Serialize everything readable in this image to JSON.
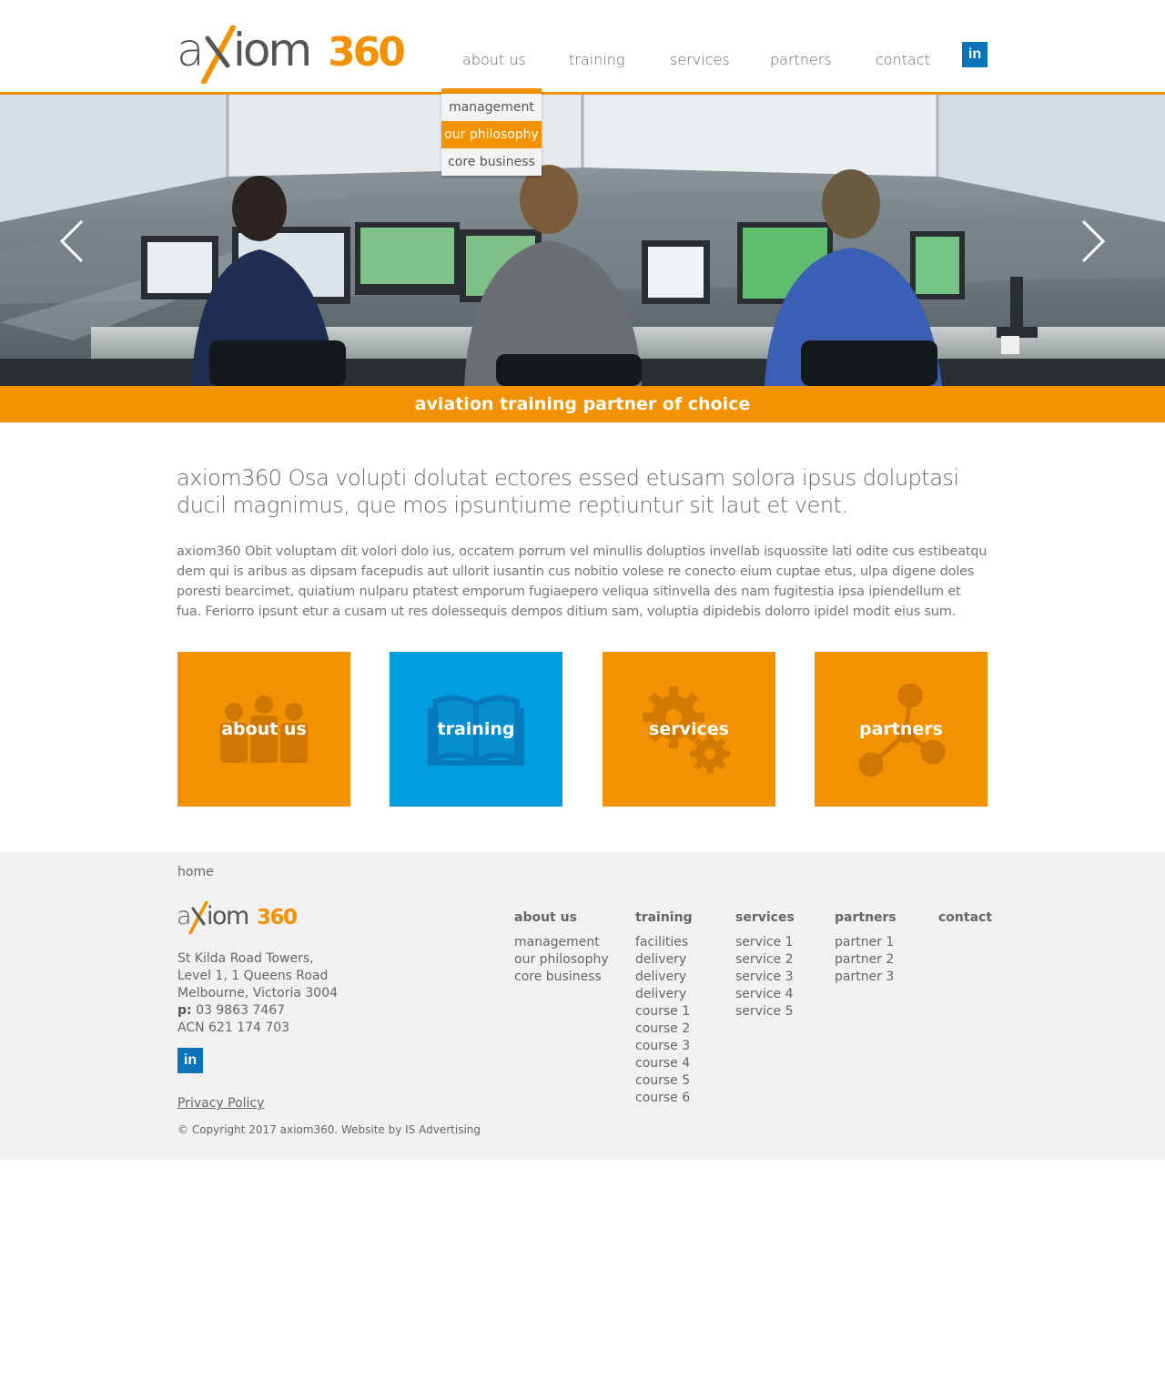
{
  "brand": {
    "logo_text_left": "axiom",
    "logo_text_right": "360",
    "orange": "#f39200",
    "blue": "#009de0",
    "linkedin_blue": "#0b73b7"
  },
  "nav": {
    "items": [
      "about us",
      "training",
      "services",
      "partners",
      "contact"
    ],
    "linkedin_label": "in"
  },
  "dropdown": {
    "items": [
      "management",
      "our philosophy",
      "core business"
    ],
    "active": "our philosophy"
  },
  "hero": {
    "tagline": "aviation training partner of choice"
  },
  "intro": {
    "lead": "axiom360 Osa volupti dolutat ectores essed etusam solora ipsus doluptasi ducil magnimus, que mos ipsuntiume reptiuntur sit laut et vent.",
    "body": "axiom360 Obit voluptam dit volori dolo ius, occatem porrum vel minullis doluptios invellab isquossite lati odite cus estibeatqu dem qui is aribus as dipsam facepudis aut ullorit iusantin cus nobitio volese re conecto eium cuptae etus, ulpa digene doles poresti bearcimet, quiatium nulparu ptatest emporum fugiaepero veliqua sitinvella des nam fugitestia ipsa ipiendellum et fua. Feriorro ipsunt etur a cusam ut res dolessequis dempos ditium sam, voluptia dipidebis dolorro ipidel modit eius sum."
  },
  "tiles": [
    {
      "label": "about us",
      "icon": "people-icon",
      "color": "#f39200"
    },
    {
      "label": "training",
      "icon": "book-icon",
      "color": "#009de0"
    },
    {
      "label": "services",
      "icon": "gears-icon",
      "color": "#f39200"
    },
    {
      "label": "partners",
      "icon": "network-icon",
      "color": "#f39200"
    }
  ],
  "footer": {
    "breadcrumb": "home",
    "address_lines": [
      "St Kilda Road Towers,",
      "Level 1, 1 Queens Road",
      "Melbourne, Victoria 3004"
    ],
    "phone_label": "p:",
    "phone": "03 9863 7467",
    "acn": "ACN 621 174 703",
    "linkedin_label": "in",
    "privacy": "Privacy Policy",
    "copyright": "© Copyright 2017 axiom360. Website by IS Advertising",
    "columns": [
      {
        "heading": "about us",
        "items": [
          "management",
          "our philosophy",
          "core business"
        ]
      },
      {
        "heading": "training",
        "items": [
          "facilities",
          "delivery",
          "delivery",
          "delivery",
          "course 1",
          "course 2",
          "course 3",
          "course 4",
          "course 5",
          "course 6"
        ]
      },
      {
        "heading": "services",
        "items": [
          "service 1",
          "service 2",
          "service 3",
          "service 4",
          "service 5"
        ]
      },
      {
        "heading": "partners",
        "items": [
          "partner 1",
          "partner 2",
          "partner 3"
        ]
      },
      {
        "heading": "contact",
        "items": []
      }
    ]
  }
}
